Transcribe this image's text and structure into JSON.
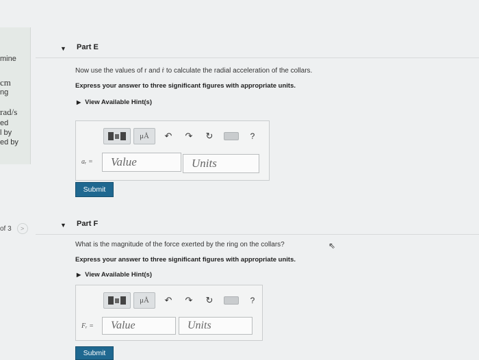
{
  "sidebar": {
    "lines": [
      {
        "text": "mine",
        "serif": false
      },
      {
        "text": "cm",
        "serif": true
      },
      {
        "text": "ng",
        "serif": false
      },
      {
        "text": "rad/s",
        "serif": true
      },
      {
        "text": "ed",
        "serif": false
      },
      {
        "text": "l by",
        "serif": false
      },
      {
        "text": "ed by",
        "serif": false
      }
    ],
    "pager": "of 3",
    "pager_next": ">"
  },
  "parts": [
    {
      "title": "Part E",
      "question": "Now use the values of r and ṙ to calculate the radial acceleration of the collars.",
      "instruction": "Express your answer to three significant figures with appropriate units.",
      "hints": "View Available Hint(s)",
      "variable": "aᵣ =",
      "value_placeholder": "Value",
      "units_placeholder": "Units",
      "submit": "Submit"
    },
    {
      "title": "Part F",
      "question": "What is the magnitude of the force exerted by the ring on the collars?",
      "instruction": "Express your answer to three significant figures with appropriate units.",
      "hints": "View Available Hint(s)",
      "variable": "Fᵣ =",
      "value_placeholder": "Value",
      "units_placeholder": "Units",
      "submit": "Submit"
    }
  ],
  "toolbar": {
    "mu_label": "μÅ",
    "undo": "↶",
    "redo": "↷",
    "reset": "↻",
    "help": "?"
  },
  "icons": {
    "caret": "caret-down-icon",
    "hint_arrow": "triangle-right-icon",
    "cursor": "mouse-cursor-icon"
  },
  "colors": {
    "submit_bg": "#1f6890",
    "page_bg": "#eef0f1"
  }
}
